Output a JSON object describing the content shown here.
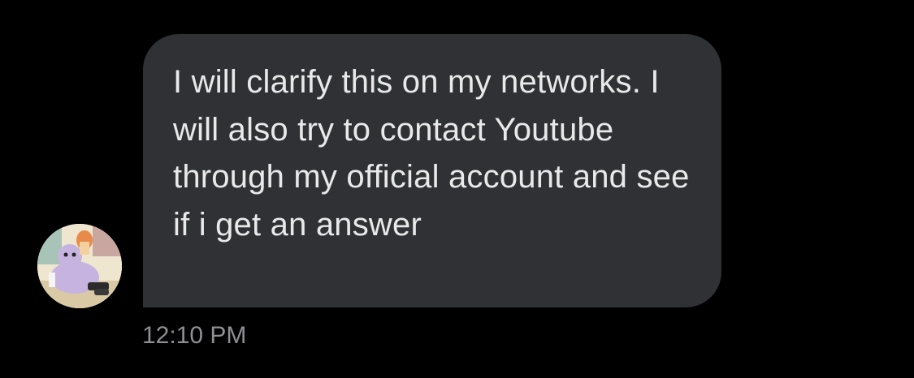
{
  "conversation": {
    "message": {
      "text": "I will clarify this on my networks. I will also try to contact Youtube through my official account and see if i get an answer",
      "timestamp": "12:10 PM"
    },
    "sender": {
      "avatar_icon": "cartoon-character-avatar"
    }
  },
  "colors": {
    "background": "#000000",
    "bubble": "#2f3135",
    "text": "#e9e9ea",
    "timestamp": "#8e8e93"
  }
}
